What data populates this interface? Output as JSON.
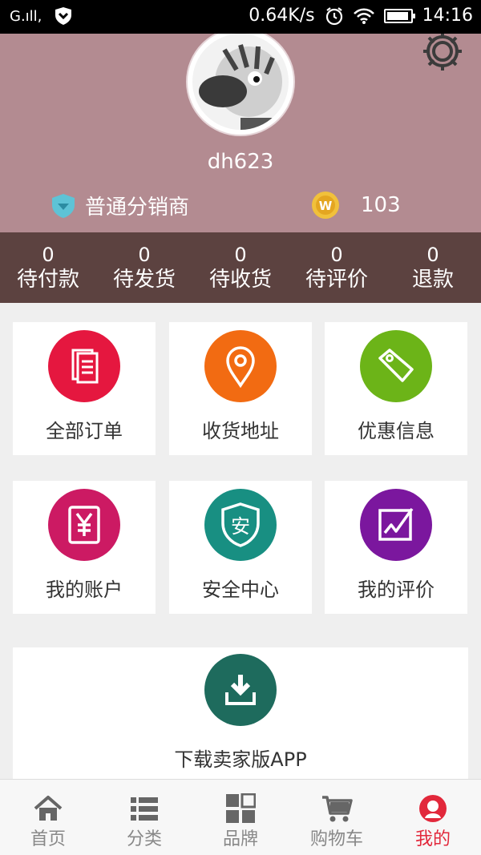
{
  "statusbar": {
    "carrier": "G.ıll,",
    "speed": "0.64K/s",
    "time": "14:16"
  },
  "profile": {
    "username": "dh623",
    "level": "普通分销商",
    "coins": "103",
    "colors": {
      "header_bg": "#b38b91"
    }
  },
  "orders": [
    {
      "count": "0",
      "label": "待付款"
    },
    {
      "count": "0",
      "label": "待发货"
    },
    {
      "count": "0",
      "label": "待收货"
    },
    {
      "count": "0",
      "label": "待评价"
    },
    {
      "count": "0",
      "label": "退款"
    }
  ],
  "grid": [
    {
      "label": "全部订单",
      "icon": "document-icon",
      "color": "#e5173f"
    },
    {
      "label": "收货地址",
      "icon": "location-pin-icon",
      "color": "#f26b12"
    },
    {
      "label": "优惠信息",
      "icon": "price-tag-icon",
      "color": "#6cb418"
    },
    {
      "label": "我的账户",
      "icon": "yen-wallet-icon",
      "color": "#cc1a63"
    },
    {
      "label": "安全中心",
      "icon": "shield-icon",
      "color": "#188f82"
    },
    {
      "label": "我的评价",
      "icon": "edit-frame-icon",
      "color": "#7b179e"
    }
  ],
  "download": {
    "label": "下载卖家版APP",
    "icon": "download-icon",
    "color": "#1e6b5d"
  },
  "tabs": [
    {
      "label": "首页",
      "icon": "home-icon",
      "active": false
    },
    {
      "label": "分类",
      "icon": "list-icon",
      "active": false
    },
    {
      "label": "品牌",
      "icon": "grid-icon",
      "active": false
    },
    {
      "label": "购物车",
      "icon": "cart-icon",
      "active": false
    },
    {
      "label": "我的",
      "icon": "user-icon",
      "active": true
    }
  ]
}
